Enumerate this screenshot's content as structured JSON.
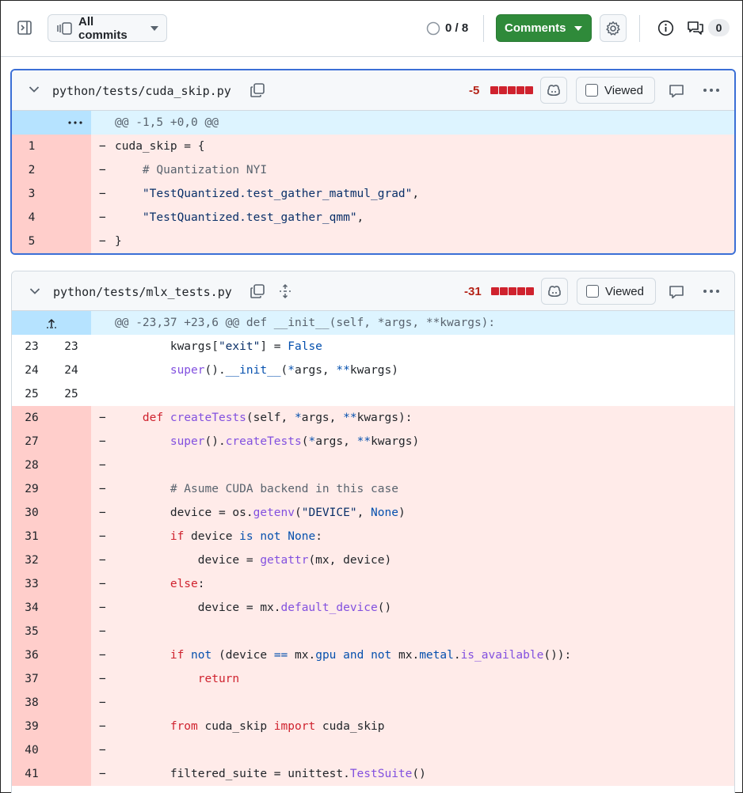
{
  "toolbar": {
    "all_commits_label": "All commits",
    "progress": "0 / 8",
    "comments_label": "Comments",
    "conversations_count": "0"
  },
  "files": [
    {
      "path": "python/tests/cuda_skip.py",
      "deletions": "-5",
      "viewed_label": "Viewed",
      "hunk": "@@ -1,5 +0,0 @@",
      "lines": [
        {
          "old": "1",
          "new": "",
          "type": "del",
          "sign": "-",
          "html": "cuda_skip = {"
        },
        {
          "old": "2",
          "new": "",
          "type": "del",
          "sign": "-",
          "html": "    <span class=\"cm\"># Quantization NYI</span>"
        },
        {
          "old": "3",
          "new": "",
          "type": "del",
          "sign": "-",
          "html": "    <span class=\"st\">\"TestQuantized.test_gather_matmul_grad\"</span>,"
        },
        {
          "old": "4",
          "new": "",
          "type": "del",
          "sign": "-",
          "html": "    <span class=\"st\">\"TestQuantized.test_gather_qmm\"</span>,"
        },
        {
          "old": "5",
          "new": "",
          "type": "del",
          "sign": "-",
          "html": "}"
        }
      ]
    },
    {
      "path": "python/tests/mlx_tests.py",
      "deletions": "-31",
      "viewed_label": "Viewed",
      "hunk": "@@ -23,37 +23,6 @@ def __init__(self, *args, **kwargs):",
      "lines": [
        {
          "old": "23",
          "new": "23",
          "type": "ctx",
          "sign": " ",
          "html": "        kwargs[<span class=\"st\">\"exit\"</span>] = <span class=\"bl\">False</span>"
        },
        {
          "old": "24",
          "new": "24",
          "type": "ctx",
          "sign": " ",
          "html": "        <span class=\"fn\">super</span>().<span class=\"bl\">__init__</span>(<span class=\"bl\">*</span>args, <span class=\"bl\">**</span>kwargs)"
        },
        {
          "old": "25",
          "new": "25",
          "type": "ctx",
          "sign": " ",
          "html": ""
        },
        {
          "old": "26",
          "new": "",
          "type": "del",
          "sign": "-",
          "html": "    <span class=\"kw\">def</span> <span class=\"fn\">createTests</span>(self, <span class=\"bl\">*</span>args, <span class=\"bl\">**</span>kwargs):"
        },
        {
          "old": "27",
          "new": "",
          "type": "del",
          "sign": "-",
          "html": "        <span class=\"fn\">super</span>().<span class=\"fn\">createTests</span>(<span class=\"bl\">*</span>args, <span class=\"bl\">**</span>kwargs)"
        },
        {
          "old": "28",
          "new": "",
          "type": "del",
          "sign": "-",
          "html": ""
        },
        {
          "old": "29",
          "new": "",
          "type": "del",
          "sign": "-",
          "html": "        <span class=\"cm\"># Asume CUDA backend in this case</span>"
        },
        {
          "old": "30",
          "new": "",
          "type": "del",
          "sign": "-",
          "html": "        device = os.<span class=\"fn\">getenv</span>(<span class=\"st\">\"DEVICE\"</span>, <span class=\"bl\">None</span>)"
        },
        {
          "old": "31",
          "new": "",
          "type": "del",
          "sign": "-",
          "html": "        <span class=\"kw\">if</span> device <span class=\"bl\">is not</span> <span class=\"bl\">None</span>:"
        },
        {
          "old": "32",
          "new": "",
          "type": "del",
          "sign": "-",
          "html": "            device = <span class=\"fn\">getattr</span>(mx, device)"
        },
        {
          "old": "33",
          "new": "",
          "type": "del",
          "sign": "-",
          "html": "        <span class=\"kw\">else</span>:"
        },
        {
          "old": "34",
          "new": "",
          "type": "del",
          "sign": "-",
          "html": "            device = mx.<span class=\"fn\">default_device</span>()"
        },
        {
          "old": "35",
          "new": "",
          "type": "del",
          "sign": "-",
          "html": ""
        },
        {
          "old": "36",
          "new": "",
          "type": "del",
          "sign": "-",
          "html": "        <span class=\"kw\">if</span> <span class=\"bl\">not</span> (device <span class=\"bl\">==</span> mx.<span class=\"bl\">gpu</span> <span class=\"bl\">and not</span> mx.<span class=\"bl\">metal</span>.<span class=\"fn\">is_available</span>()):"
        },
        {
          "old": "37",
          "new": "",
          "type": "del",
          "sign": "-",
          "html": "            <span class=\"kw\">return</span>"
        },
        {
          "old": "38",
          "new": "",
          "type": "del",
          "sign": "-",
          "html": ""
        },
        {
          "old": "39",
          "new": "",
          "type": "del",
          "sign": "-",
          "html": "        <span class=\"kw\">from</span> cuda_skip <span class=\"kw\">import</span> cuda_skip"
        },
        {
          "old": "40",
          "new": "",
          "type": "del",
          "sign": "-",
          "html": ""
        },
        {
          "old": "41",
          "new": "",
          "type": "del",
          "sign": "-",
          "html": "        filtered_suite = unittest.<span class=\"fn\">TestSuite</span>()"
        }
      ]
    }
  ]
}
